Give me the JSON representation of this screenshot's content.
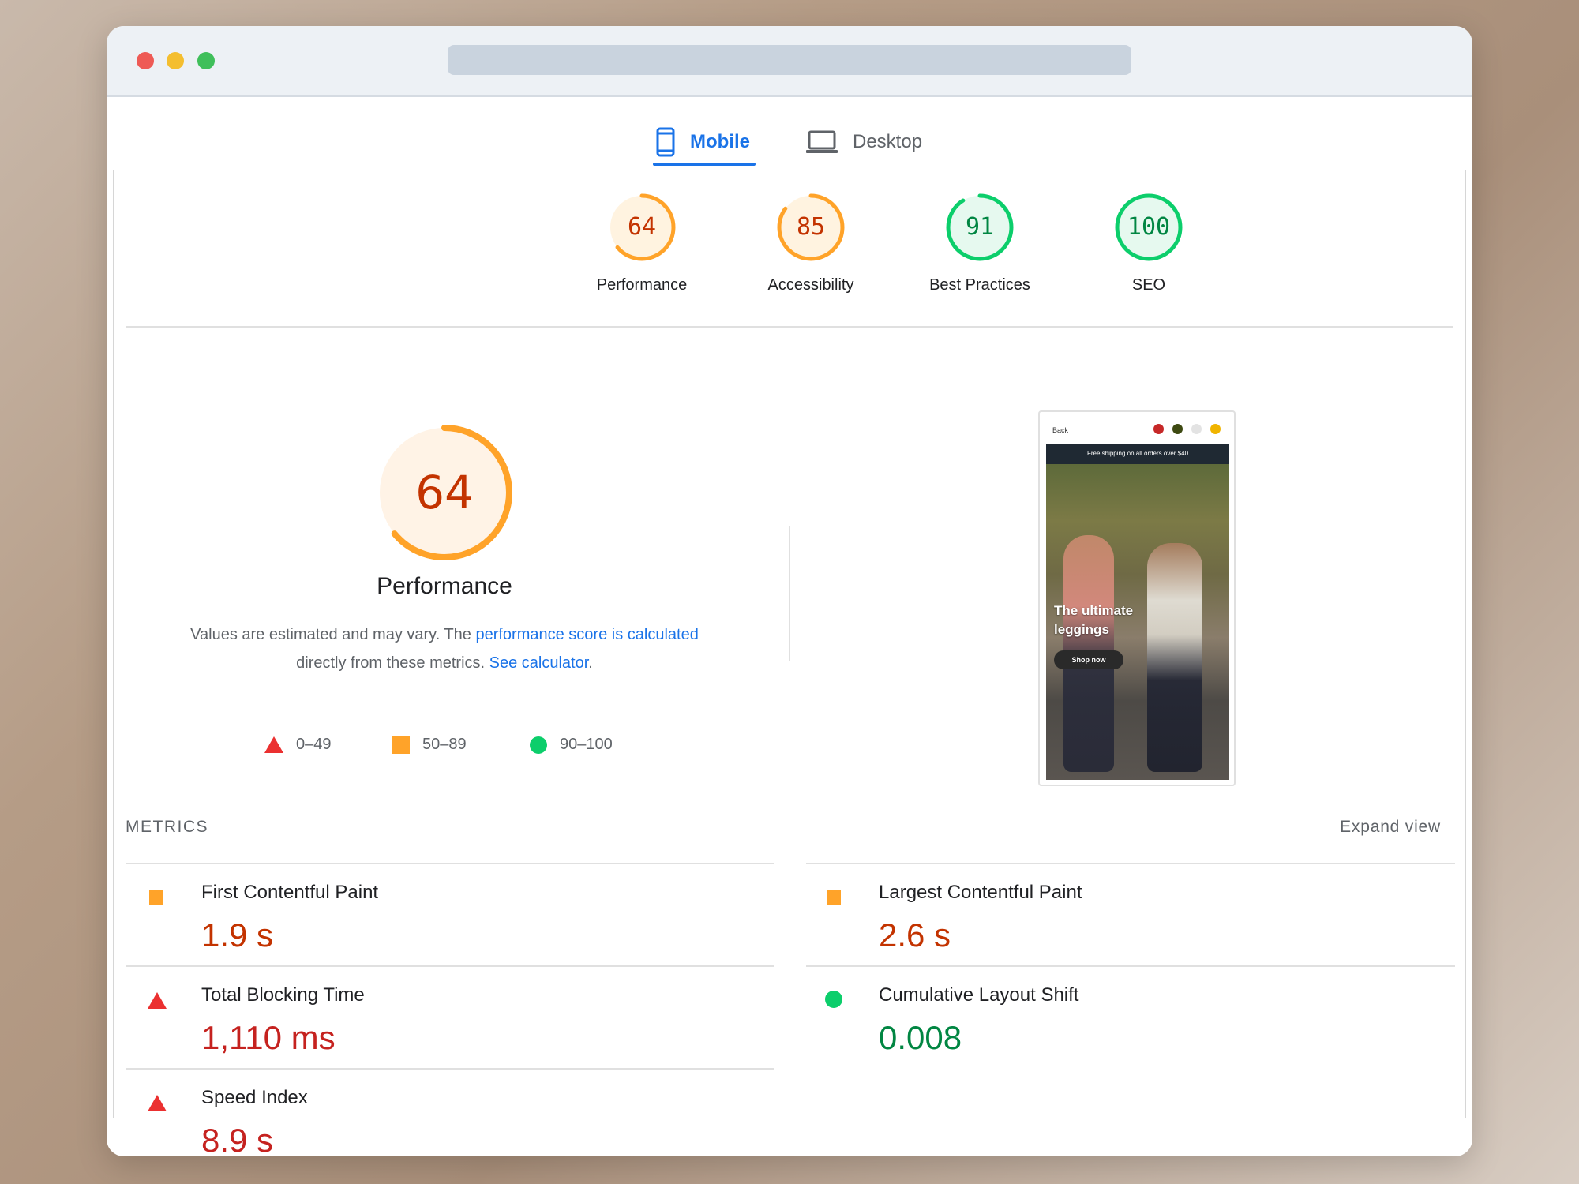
{
  "tabs": [
    {
      "label": "Mobile",
      "active": true,
      "icon": "mobile-phone-icon"
    },
    {
      "label": "Desktop",
      "active": false,
      "icon": "laptop-icon"
    }
  ],
  "categories": [
    {
      "score": "64",
      "label": "Performance",
      "level": "average"
    },
    {
      "score": "85",
      "label": "Accessibility",
      "level": "average"
    },
    {
      "score": "91",
      "label": "Best Practices",
      "level": "pass"
    },
    {
      "score": "100",
      "label": "SEO",
      "level": "pass"
    }
  ],
  "performance": {
    "score": "64",
    "title": "Performance",
    "desc_prefix": "Values are estimated and may vary. The ",
    "desc_link1": "performance score is calculated",
    "desc_middle": " directly from these metrics. ",
    "desc_link2": "See calculator",
    "desc_suffix": "."
  },
  "legend": [
    {
      "range": "0–49",
      "shape": "triangle",
      "color": "#eb3030"
    },
    {
      "range": "50–89",
      "shape": "square",
      "color": "#ffa329"
    },
    {
      "range": "90–100",
      "shape": "circle",
      "color": "#0cce6b"
    }
  ],
  "screenshot": {
    "back": "Back",
    "banner": "Free shipping on all orders over $40",
    "headline_1": "The ultimate",
    "headline_2": "leggings",
    "button": "Shop now",
    "swatches": [
      "#c62828",
      "#3e4a12",
      "#e3e3e3",
      "#f0b400"
    ]
  },
  "metrics": {
    "label": "METRICS",
    "expand": "Expand view",
    "items": [
      {
        "name": "First Contentful Paint",
        "value": "1.9 s",
        "status": "average"
      },
      {
        "name": "Largest Contentful Paint",
        "value": "2.6 s",
        "status": "average"
      },
      {
        "name": "Total Blocking Time",
        "value": "1,110 ms",
        "status": "fail"
      },
      {
        "name": "Cumulative Layout Shift",
        "value": "0.008",
        "status": "pass"
      },
      {
        "name": "Speed Index",
        "value": "8.9 s",
        "status": "fail"
      }
    ]
  },
  "colors": {
    "fail": "#eb3030",
    "fail_text": "#c5221f",
    "average": "#ffa329",
    "average_text": "#c33300",
    "pass": "#0cce6b",
    "pass_text": "#018642",
    "accent": "#1a73e8"
  }
}
